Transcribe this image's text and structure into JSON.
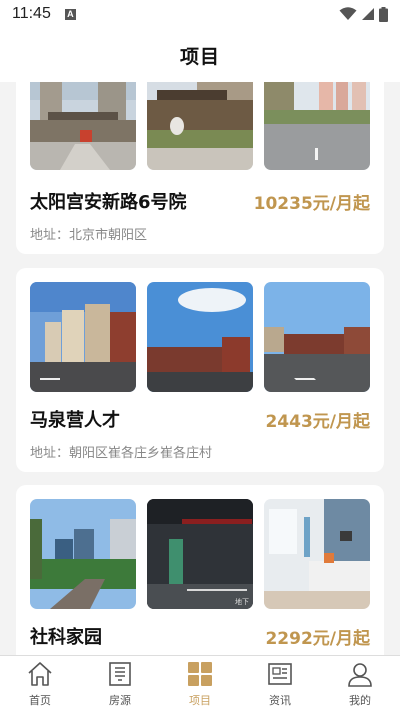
{
  "status_bar": {
    "time": "11:45",
    "notification_letter": "A",
    "icons": [
      "wifi-icon",
      "signal-icon",
      "battery-icon"
    ]
  },
  "header": {
    "title": "项目"
  },
  "projects": [
    {
      "name": "太阳宫安新路6号院",
      "price": "10235元/月起",
      "address": "地址：北京市朝阳区"
    },
    {
      "name": "马泉营人才",
      "price": "2443元/月起",
      "address": "地址：朝阳区崔各庄乡崔各庄村"
    },
    {
      "name": "社科家园",
      "price": "2292元/月起",
      "photo_caption": "地下"
    }
  ],
  "tab_bar": {
    "active": "项目",
    "active_color": "#c8a060",
    "tabs": [
      {
        "label": "首页",
        "icon": "home-icon"
      },
      {
        "label": "房源",
        "icon": "building-icon"
      },
      {
        "label": "项目",
        "icon": "grid-icon"
      },
      {
        "label": "资讯",
        "icon": "news-icon"
      },
      {
        "label": "我的",
        "icon": "user-icon"
      }
    ]
  },
  "colors": {
    "price": "#c0964f",
    "accent": "#c8a060",
    "background": "#f3f3f3"
  }
}
